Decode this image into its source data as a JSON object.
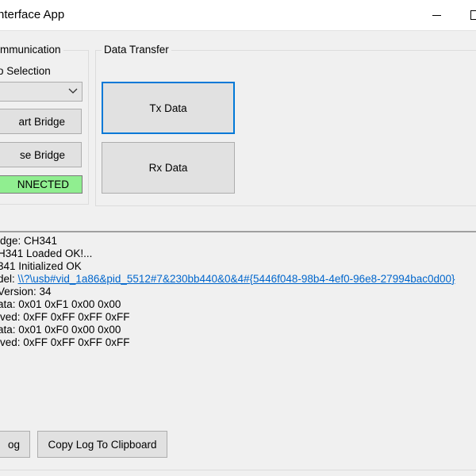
{
  "window": {
    "title": "nterface App"
  },
  "communication": {
    "group_label": "mmunication",
    "selection_label": "o Selection",
    "combo_value": "",
    "start_bridge_label": "art Bridge",
    "close_bridge_label": "se Bridge",
    "status_text": "NNECTED",
    "status_color": "#90ee90"
  },
  "data_transfer": {
    "group_label": "Data Transfer",
    "tx_label": "Tx Data",
    "rx_label": "Rx Data"
  },
  "log": {
    "lines": [
      {
        "text": "idge: CH341"
      },
      {
        "text": "H341 Loaded OK!..."
      },
      {
        "text": "341  Initialized OK"
      },
      {
        "prefix": "del: ",
        "link": "\\\\?\\usb#vid_1a86&pid_5512#7&230bb440&0&4#{5446f048-98b4-4ef0-96e8-27994bac0d00}"
      },
      {
        "text": " Version: 34"
      },
      {
        "text": "ata: 0x01 0xF1 0x00 0x00"
      },
      {
        "text": "ived: 0xFF 0xFF 0xFF 0xFF"
      },
      {
        "text": "ata: 0x01 0xF0 0x00 0x00"
      },
      {
        "text": "ived: 0xFF 0xFF 0xFF 0xFF"
      }
    ]
  },
  "bottom": {
    "clear_log_label": "og",
    "copy_log_label": "Copy Log To Clipboard"
  },
  "icons": {
    "minimize": "minimize-icon",
    "maximize": "maximize-icon",
    "dropdown": "chevron-down-icon"
  }
}
